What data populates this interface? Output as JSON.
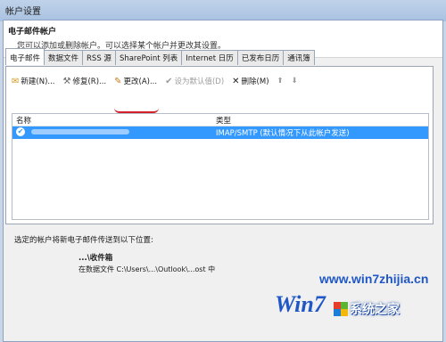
{
  "window": {
    "title": "帐户设置"
  },
  "header": {
    "title": "电子邮件帐户",
    "description": "您可以添加或删除帐户。可以选择某个帐户并更改其设置。"
  },
  "tabs": [
    "电子邮件",
    "数据文件",
    "RSS 源",
    "SharePoint 列表",
    "Internet 日历",
    "已发布日历",
    "通讯簿"
  ],
  "toolbar": {
    "new_label": "新建(N)...",
    "repair_label": "修复(R)...",
    "change_label": "更改(A)...",
    "set_default_label": "设为默认值(D)",
    "delete_label": "删除(M)",
    "up_arrow": "⬆",
    "down_arrow": "⬇"
  },
  "list": {
    "headers": {
      "name": "名称",
      "type": "类型"
    },
    "rows": [
      {
        "name": "",
        "type": "IMAP/SMTP (默认情况下从此帐户发送)"
      }
    ]
  },
  "delivery": {
    "label": "选定的帐户将新电子邮件传送到以下位置:",
    "mailbox": "...\\收件箱",
    "data_file": "在数据文件 C:\\Users\\...\\Outlook\\...ost 中"
  },
  "watermark": {
    "top": "www.win7zhijia.cn",
    "logo": "Win7",
    "right": "系统之家"
  }
}
